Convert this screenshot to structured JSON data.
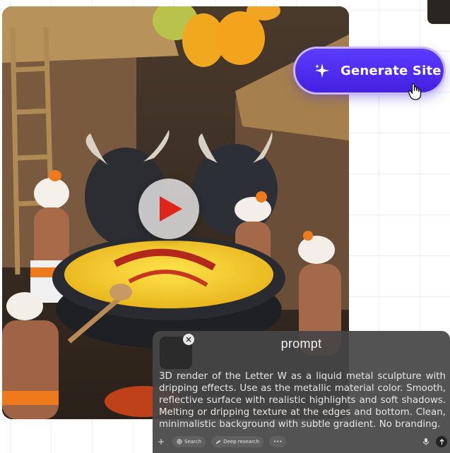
{
  "generate_button": {
    "label": "Generate Site",
    "icon": "sparkle-icon",
    "color": "#4a27ea"
  },
  "media": {
    "subject_alt": "",
    "play_icon": "play-icon"
  },
  "prompt_panel": {
    "brand": "prompt",
    "text": "3D render of the Letter W as a liquid metal sculpture with dripping effects. Use as the metallic material color. Smooth, reflective surface with realistic highlights and soft shadows. Melting or dripping texture at the edges and bottom. Clean, minimalistic background with subtle gradient. No branding.",
    "toolbar": {
      "search_label": "Search",
      "deep_research_label": "Deep research",
      "more_label": "•••"
    }
  }
}
